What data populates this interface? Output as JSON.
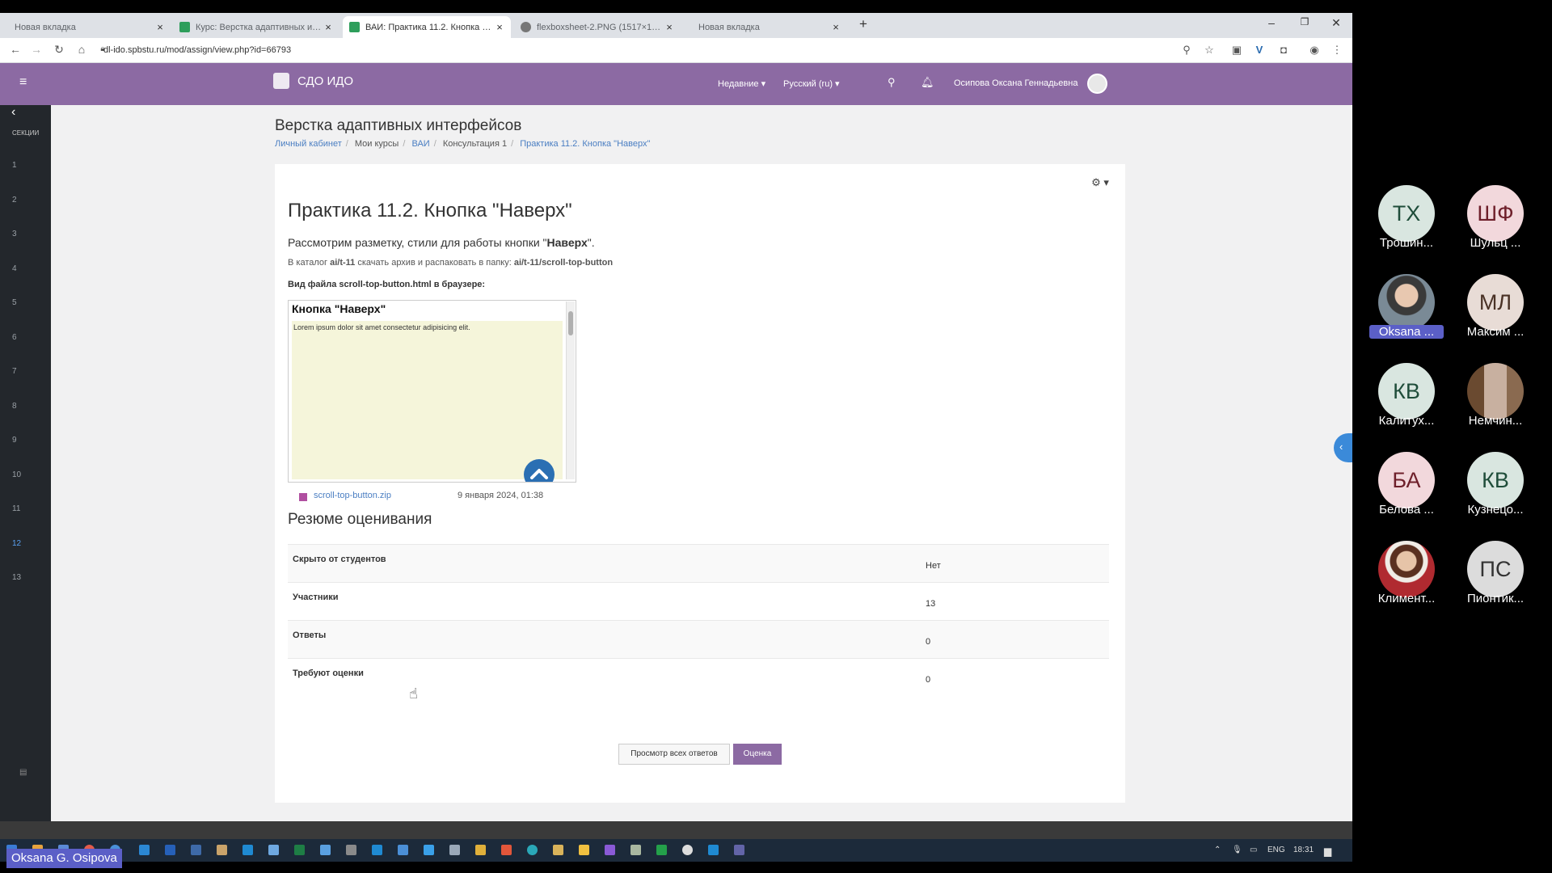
{
  "browser": {
    "tabs": [
      {
        "title": "Новая вкладка",
        "active": false
      },
      {
        "title": "Курс: Верстка адаптивных интерфейсов",
        "active": false
      },
      {
        "title": "ВАИ: Практика 11.2. Кнопка \"Наверх\"",
        "active": true
      },
      {
        "title": "flexboxsheet-2.PNG (1517×1000)",
        "active": false
      },
      {
        "title": "Новая вкладка",
        "active": false
      }
    ],
    "url": "dl-ido.spbstu.ru/mod/assign/view.php?id=66793"
  },
  "navbar": {
    "site_name": "СДО ИДО",
    "recent": "Недавние ▾",
    "language": "Русский (ru) ▾",
    "user_name": "Осипова Оксана Геннадьевна"
  },
  "drawer": {
    "label": "СЕКЦИИ",
    "sections": [
      "1",
      "2",
      "3",
      "4",
      "5",
      "6",
      "7",
      "8",
      "9",
      "10",
      "11",
      "12",
      "13"
    ],
    "active_section": "12"
  },
  "page": {
    "course_title": "Верстка адаптивных интерфейсов",
    "breadcrumbs": [
      {
        "text": "Личный кабинет",
        "link": true
      },
      {
        "text": "Мои курсы",
        "link": false
      },
      {
        "text": "ВАИ",
        "link": true
      },
      {
        "text": "Консультация 1",
        "link": false
      },
      {
        "text": "Практика 11.2. Кнопка \"Наверх\"",
        "link": true
      }
    ],
    "assignment_title": "Практика 11.2. Кнопка \"Наверх\"",
    "intro_prefix": "Рассмотрим разметку, стили для работы кнопки \"",
    "intro_bold": "Наверх",
    "intro_suffix": "\".",
    "catalog_a": "В каталог ",
    "catalog_b": "ai/t-11",
    "catalog_c": " скачать архив и распаковать в папку: ",
    "catalog_d": "ai/t-11/scroll-top-button",
    "view_label": "Вид файла scroll-top-button.html в браузере:",
    "preview": {
      "title": "Кнопка \"Наверх\"",
      "lorem": "Lorem ipsum dolor sit amet consectetur adipisicing elit."
    },
    "attachment": {
      "name": "scroll-top-button.zip",
      "date": "9 января 2024, 01:38"
    },
    "summary_title": "Резюме оценивания",
    "grading": [
      {
        "label": "Скрыто от студентов",
        "value": "Нет"
      },
      {
        "label": "Участники",
        "value": "13"
      },
      {
        "label": "Ответы",
        "value": "0"
      },
      {
        "label": "Требуют оценки",
        "value": "0"
      }
    ],
    "view_all_button": "Просмотр всех ответов",
    "grade_button": "Оценка"
  },
  "taskbar": {
    "lang": "ENG",
    "time": "18:31"
  },
  "participants": [
    {
      "initials": "ТХ",
      "name": "Трошин...",
      "bg": "#d9e6e0",
      "fg": "#1f4d3a"
    },
    {
      "initials": "ШФ",
      "name": "Шульц ...",
      "bg": "#f2d8dc",
      "fg": "#6e1f2a"
    },
    {
      "initials": "",
      "name": "Oksana ...",
      "bg": "#8c9aa6",
      "fg": "#fff"
    },
    {
      "initials": "МЛ",
      "name": "Максим ...",
      "bg": "#e8dcd6",
      "fg": "#4a3226"
    },
    {
      "initials": "КВ",
      "name": "Калитух...",
      "bg": "#d9e6e0",
      "fg": "#1f4d3a"
    },
    {
      "initials": "",
      "name": "Немчин...",
      "bg": "#a07b5c",
      "fg": "#fff"
    },
    {
      "initials": "БА",
      "name": "Белова ...",
      "bg": "#f2d8dc",
      "fg": "#6e1f2a"
    },
    {
      "initials": "КВ",
      "name": "Кузнецо...",
      "bg": "#d9e6e0",
      "fg": "#1f4d3a"
    },
    {
      "initials": "",
      "name": "Климент...",
      "bg": "#c8b4a4",
      "fg": "#fff"
    },
    {
      "initials": "ПС",
      "name": "Пионтик...",
      "bg": "#dcdcdc",
      "fg": "#333"
    }
  ],
  "self_label": "Oksana G. Osipova"
}
